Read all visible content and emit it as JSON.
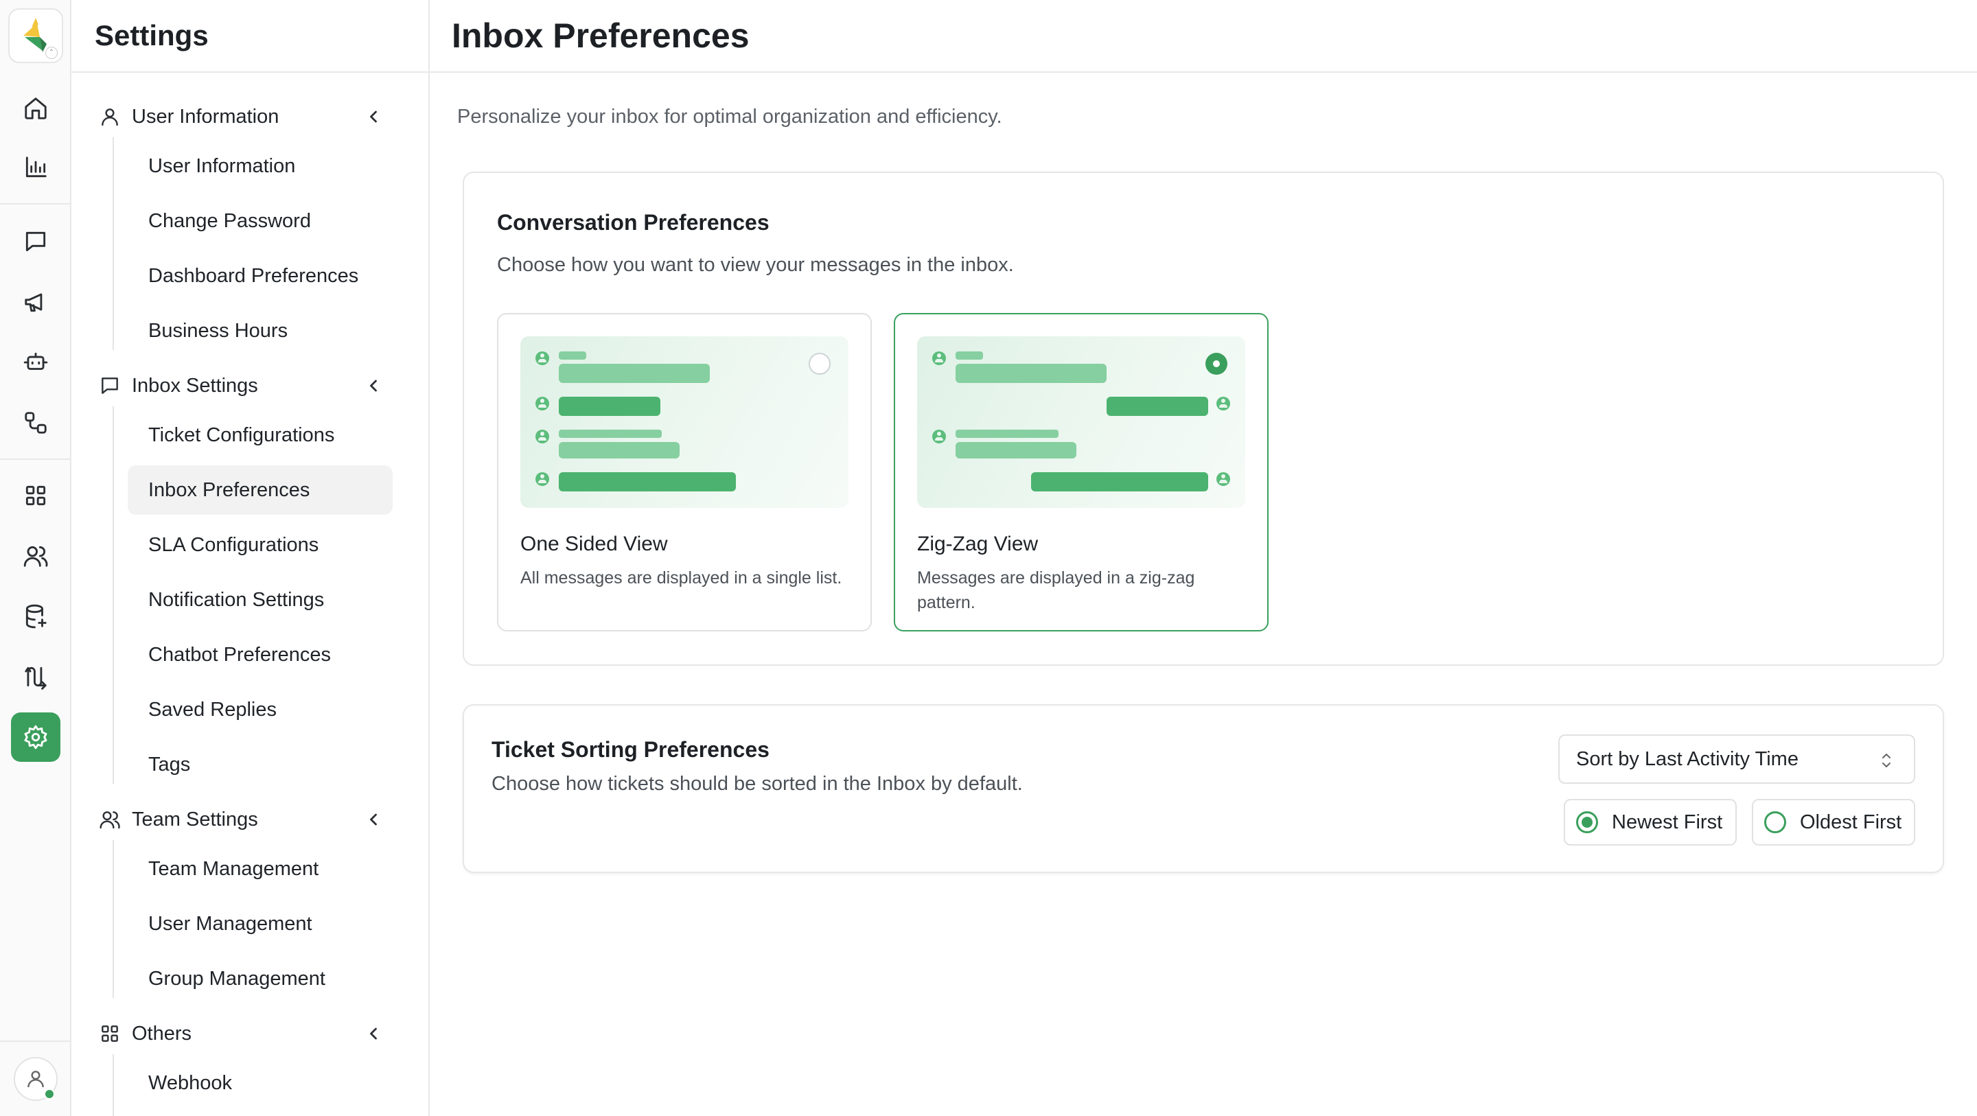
{
  "sidebar": {
    "title": "Settings",
    "groups": [
      {
        "label": "User Information",
        "items": [
          "User Information",
          "Change Password",
          "Dashboard Preferences",
          "Business Hours"
        ]
      },
      {
        "label": "Inbox Settings",
        "items": [
          "Ticket Configurations",
          "Inbox Preferences",
          "SLA Configurations",
          "Notification Settings",
          "Chatbot Preferences",
          "Saved Replies",
          "Tags"
        ]
      },
      {
        "label": "Team Settings",
        "items": [
          "Team Management",
          "User Management",
          "Group Management"
        ]
      },
      {
        "label": "Others",
        "items": [
          "Webhook"
        ]
      }
    ],
    "active_item": "Inbox Preferences"
  },
  "rail": {
    "icons": [
      "home-icon",
      "bar-chart-icon",
      "message-icon",
      "megaphone-icon",
      "bot-icon",
      "workflow-icon",
      "grid-icon",
      "users-icon",
      "database-icon",
      "route-icon",
      "settings-icon"
    ],
    "active": "settings-icon"
  },
  "main": {
    "title": "Inbox Preferences",
    "subtitle": "Personalize your inbox for optimal organization and efficiency.",
    "conversation": {
      "title": "Conversation Preferences",
      "subtitle": "Choose how you want to view your messages in the inbox.",
      "options": [
        {
          "title": "One Sided View",
          "description": "All messages are displayed in a single list.",
          "selected": false
        },
        {
          "title": "Zig-Zag View",
          "description": "Messages are displayed in a zig-zag pattern.",
          "selected": true
        }
      ]
    },
    "sorting": {
      "title": "Ticket Sorting Preferences",
      "subtitle": "Choose how tickets should be sorted in the Inbox by default.",
      "select_value": "Sort by Last Activity Time",
      "order_options": [
        {
          "label": "Newest First",
          "selected": true
        },
        {
          "label": "Oldest First",
          "selected": false
        }
      ]
    }
  },
  "colors": {
    "accent": "#3a9f5c",
    "preview_light": "#86cfa0",
    "preview_dark": "#4bb36f"
  }
}
